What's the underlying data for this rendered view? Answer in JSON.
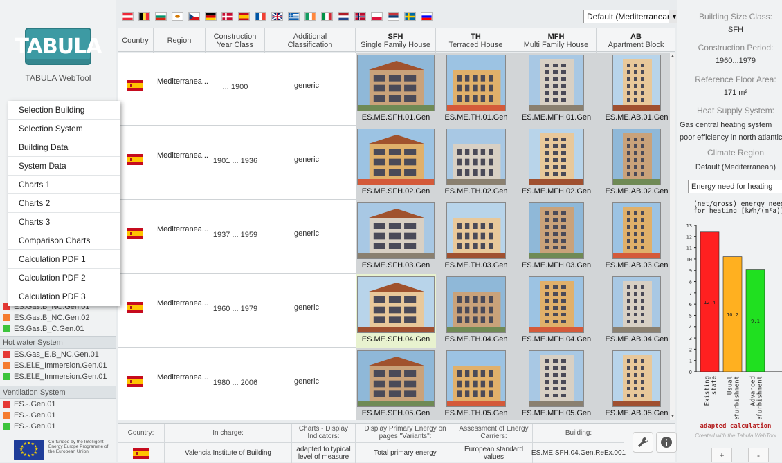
{
  "app": {
    "logo_text": "TABULA",
    "caption": "TABULA WebTool"
  },
  "menu": [
    "Selection Building",
    "Selection System",
    "Building Data",
    "System Data",
    "Charts 1",
    "Charts 2",
    "Charts 3",
    "Comparison Charts",
    "Calculation PDF 1",
    "Calculation PDF 2",
    "Calculation PDF 3"
  ],
  "systems": {
    "heating_items": [
      {
        "label": "ES.Gas.B_NC.Gen.01",
        "color": "#e53935"
      },
      {
        "label": "ES.Gas.B_NC.Gen.02",
        "color": "#f57c30"
      },
      {
        "label": "ES.Gas.B_C.Gen.01",
        "color": "#3cc43c"
      }
    ],
    "hot_water_head": "Hot water System",
    "hot_water_items": [
      {
        "label": "ES.Gas_E.B_NC.Gen.01",
        "color": "#e53935"
      },
      {
        "label": "ES.El.E_Immersion.Gen.01",
        "color": "#f57c30"
      },
      {
        "label": "ES.El.E_Immersion.Gen.01",
        "color": "#3cc43c"
      }
    ],
    "ventilation_head": "Ventilation System",
    "ventilation_items": [
      {
        "label": "ES.-.Gen.01",
        "color": "#e53935"
      },
      {
        "label": "ES.-.Gen.01",
        "color": "#f57c30"
      },
      {
        "label": "ES.-.Gen.01",
        "color": "#3cc43c"
      }
    ]
  },
  "eu_text": "Co-funded by the Intelligent Energy Europe Programme of the European Union",
  "flags": [
    "AT",
    "BE",
    "BG",
    "CY",
    "CZ",
    "DE",
    "DK",
    "ES",
    "FR",
    "GB",
    "GR",
    "IE",
    "IT",
    "NL",
    "NO",
    "PL",
    "RS",
    "SE",
    "SI"
  ],
  "climate_select": "Default (Mediterranean)",
  "table": {
    "headers": {
      "country": "Country",
      "region": "Region",
      "year": "Construction Year Class",
      "additional": "Additional Classification",
      "sfh": "SFH",
      "sfh_sub": "Single Family House",
      "th": "TH",
      "th_sub": "Terraced House",
      "mfh": "MFH",
      "mfh_sub": "Multi Family House",
      "ab": "AB",
      "ab_sub": "Apartment Block"
    },
    "rows": [
      {
        "region": "Mediterranea... (Clima Medite...",
        "year": "... 1900",
        "cls": "generic",
        "codes": [
          "ES.ME.SFH.01.Gen",
          "ES.ME.TH.01.Gen",
          "ES.ME.MFH.01.Gen",
          "ES.ME.AB.01.Gen"
        ]
      },
      {
        "region": "Mediterranea... (Clima Medite...",
        "year": "1901 ... 1936",
        "cls": "generic",
        "codes": [
          "ES.ME.SFH.02.Gen",
          "ES.ME.TH.02.Gen",
          "ES.ME.MFH.02.Gen",
          "ES.ME.AB.02.Gen"
        ]
      },
      {
        "region": "Mediterranea... (Clima Medite...",
        "year": "1937 ... 1959",
        "cls": "generic",
        "codes": [
          "ES.ME.SFH.03.Gen",
          "ES.ME.TH.03.Gen",
          "ES.ME.MFH.03.Gen",
          "ES.ME.AB.03.Gen"
        ]
      },
      {
        "region": "Mediterranea... (Clima Medite...",
        "year": "1960 ... 1979",
        "cls": "generic",
        "codes": [
          "ES.ME.SFH.04.Gen",
          "ES.ME.TH.04.Gen",
          "ES.ME.MFH.04.Gen",
          "ES.ME.AB.04.Gen"
        ],
        "selected": 0
      },
      {
        "region": "Mediterranea... (Clima Medite...",
        "year": "1980 ... 2006",
        "cls": "generic",
        "codes": [
          "ES.ME.SFH.05.Gen",
          "ES.ME.TH.05.Gen",
          "ES.ME.MFH.05.Gen",
          "ES.ME.AB.05.Gen"
        ]
      }
    ]
  },
  "footer": {
    "headers": [
      "Country:",
      "In charge:",
      "Charts - Display Indicators:",
      "Display Primary Energy on pages \"Variants\":",
      "Assessment of Energy Carriers:",
      "Building:"
    ],
    "values": [
      "Valencia Institute of Building",
      "adapted to typical level of measure",
      "Total primary energy",
      "European standard values",
      "ES.ME.SFH.04.Gen.ReEx.001"
    ]
  },
  "right_panel": {
    "size_label": "Building Size Class:",
    "size_value": "SFH",
    "period_label": "Construction Period:",
    "period_value": "1960...1979",
    "area_label": "Reference Floor Area:",
    "area_value": "171 m²",
    "heat_label": "Heat Supply System:",
    "heat_value": "Gas central heating system poor efficiency in north atlantic climate",
    "climate_label": "Climate Region",
    "climate_value": "Default (Mediterranean)",
    "indicator_select": "Energy need for heating",
    "chart_foot": "adapted calculation",
    "chart_credit": "Created with the Tabula WebTool",
    "plus": "+",
    "minus": "-"
  },
  "chart_data": {
    "type": "bar",
    "title": "(net/gross) energy need for heating [kWh/(m²a)]",
    "categories": [
      "Existing state",
      "Usual Refurbishment",
      "Advanced Refurbishment"
    ],
    "values": [
      12.4,
      10.2,
      9.1
    ],
    "colors": [
      "#ff2020",
      "#ffb020",
      "#20e020"
    ],
    "ylim": [
      0,
      13
    ],
    "yticks": [
      0,
      1,
      2,
      3,
      4,
      5,
      6,
      7,
      8,
      9,
      10,
      11,
      12,
      13
    ]
  }
}
